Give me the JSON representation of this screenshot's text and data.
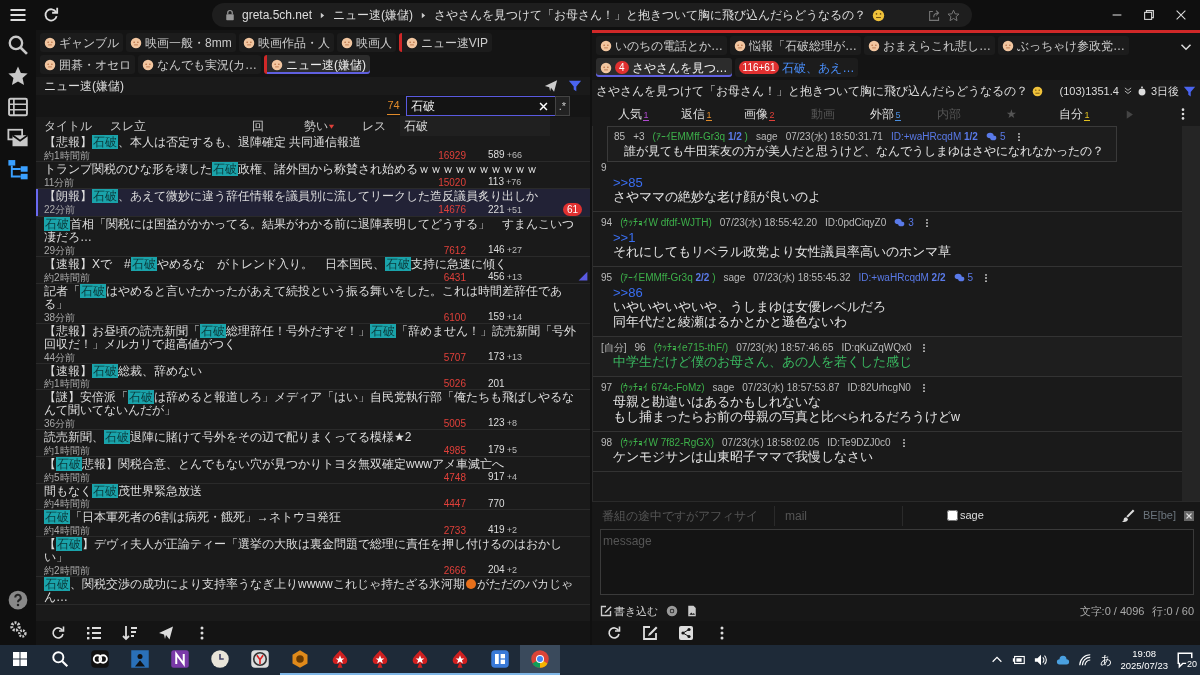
{
  "topbar": {
    "host": "greta.5ch.net",
    "crumbs": [
      "ニュー速(嫌儲)",
      "さやさんを見つけて「お母さん！」と抱きついて胸に飛び込んだらどうなるの？"
    ]
  },
  "sidebar": {
    "items": [
      {
        "kind": "search",
        "selected": false
      },
      {
        "kind": "star",
        "selected": false
      },
      {
        "kind": "list",
        "selected": false
      },
      {
        "kind": "mail",
        "selected": false
      },
      {
        "kind": "tree",
        "selected": true
      }
    ],
    "bottom": [
      {
        "kind": "help"
      },
      {
        "kind": "settings"
      }
    ]
  },
  "board_tabs": [
    {
      "label": "ギャンブル",
      "selected": false,
      "marked": false
    },
    {
      "label": "映画一般・8mm",
      "selected": false,
      "marked": false
    },
    {
      "label": "映画作品・人",
      "selected": false,
      "marked": false
    },
    {
      "label": "映画人",
      "selected": false,
      "marked": false
    },
    {
      "label": "ニュー速VIP",
      "selected": false,
      "marked": true
    },
    {
      "label": "囲碁・オセロ",
      "selected": false,
      "marked": false
    },
    {
      "label": "なんでも実況(カ…",
      "selected": false,
      "marked": false
    },
    {
      "label": "ニュー速(嫌儲)",
      "selected": true,
      "marked": true
    }
  ],
  "board_header": {
    "title": "ニュー速(嫌儲)"
  },
  "search": {
    "count": "74",
    "value": "石破",
    "regex": ".*",
    "suggestion": "石破"
  },
  "columns": [
    {
      "label": "タイトル",
      "sorted": false
    },
    {
      "label": "スレ立",
      "sorted": false
    },
    {
      "label": "回",
      "sorted": false
    },
    {
      "label": "勢い",
      "sorted": true
    },
    {
      "label": "レス",
      "sorted": false
    }
  ],
  "threads": [
    {
      "title": [
        {
          "kind": "plain",
          "text": "【悲報】"
        },
        {
          "kind": "match",
          "text": "石破"
        },
        {
          "kind": "plain",
          "text": "、本人は否定するも、退陣確定 共同通信報道"
        }
      ],
      "age": "約1時間前",
      "speed": "16929",
      "count": "589",
      "new": "+66",
      "selected": false,
      "flagged": false
    },
    {
      "title": [
        {
          "kind": "plain",
          "text": "トランプ関税のひな形を壊した"
        },
        {
          "kind": "match",
          "text": "石破"
        },
        {
          "kind": "plain",
          "text": "政権、諸外国から称賛され始めるｗｗｗｗｗｗｗｗｗｗ"
        }
      ],
      "age": "11分前",
      "speed": "15020",
      "count": "113",
      "new": "+76",
      "selected": false,
      "flagged": false
    },
    {
      "title": [
        {
          "kind": "plain",
          "text": "【朗報】"
        },
        {
          "kind": "match",
          "text": "石破"
        },
        {
          "kind": "plain",
          "text": "、あえて微妙に違う辞任情報を議員別に流してリークした造反議員炙り出しか"
        }
      ],
      "age": "22分前",
      "speed": "14676",
      "count": "221",
      "new": "+51",
      "badge": "61",
      "selected": true,
      "flagged": false
    },
    {
      "title": [
        {
          "kind": "match",
          "text": "石破"
        },
        {
          "kind": "plain",
          "text": "首相「関税には国益がかかってる。結果がわかる前に退陣表明してどうする」　すまんこいつ凄だろ…"
        }
      ],
      "age": "29分前",
      "speed": "7612",
      "count": "146",
      "new": "+27",
      "selected": false,
      "flagged": false
    },
    {
      "title": [
        {
          "kind": "plain",
          "text": "【速報】Xで　#"
        },
        {
          "kind": "match",
          "text": "石破"
        },
        {
          "kind": "plain",
          "text": "やめるな　がトレンド入り。　日本国民、"
        },
        {
          "kind": "match",
          "text": "石破"
        },
        {
          "kind": "plain",
          "text": "支持に急速に傾く"
        }
      ],
      "age": "約2時間前",
      "speed": "6431",
      "count": "456",
      "new": "+13",
      "selected": false,
      "flagged": true
    },
    {
      "title": [
        {
          "kind": "plain",
          "text": "記者「"
        },
        {
          "kind": "match",
          "text": "石破"
        },
        {
          "kind": "plain",
          "text": "はやめると言いたかったがあえて続投という振る舞いをした。これは時間差辞任である」"
        }
      ],
      "age": "38分前",
      "speed": "6100",
      "count": "159",
      "new": "+14",
      "selected": false,
      "flagged": false
    },
    {
      "title": [
        {
          "kind": "plain",
          "text": "【悲報】お昼頃の読売新聞「"
        },
        {
          "kind": "match",
          "text": "石破"
        },
        {
          "kind": "plain",
          "text": "総理辞任！号外だすぞ！」"
        },
        {
          "kind": "match",
          "text": "石破"
        },
        {
          "kind": "plain",
          "text": "「辞めません！」読売新聞「号外回収だ！」メルカリで超高値がつく"
        }
      ],
      "age": "44分前",
      "speed": "5707",
      "count": "173",
      "new": "+13",
      "selected": false,
      "flagged": false
    },
    {
      "title": [
        {
          "kind": "plain",
          "text": "【速報】"
        },
        {
          "kind": "match",
          "text": "石破"
        },
        {
          "kind": "plain",
          "text": "総裁、辞めない"
        }
      ],
      "age": "約1時間前",
      "speed": "5026",
      "count": "201",
      "selected": false,
      "flagged": false
    },
    {
      "title": [
        {
          "kind": "plain",
          "text": "【謎】安倍派「"
        },
        {
          "kind": "match",
          "text": "石破"
        },
        {
          "kind": "plain",
          "text": "は辞めると報道しろ」メディア「はい」自民党執行部「俺たちも飛ばしやるなんて聞いてないんだが」"
        }
      ],
      "age": "36分前",
      "speed": "5005",
      "count": "123",
      "new": "+8",
      "selected": false,
      "flagged": false
    },
    {
      "title": [
        {
          "kind": "plain",
          "text": "読売新聞、"
        },
        {
          "kind": "match",
          "text": "石破"
        },
        {
          "kind": "plain",
          "text": "退陣に賭けて号外をその辺で配りまくってる模様★2"
        }
      ],
      "age": "約1時間前",
      "speed": "4985",
      "count": "179",
      "new": "+5",
      "selected": false,
      "flagged": false
    },
    {
      "title": [
        {
          "kind": "plain",
          "text": "【"
        },
        {
          "kind": "match",
          "text": "石破"
        },
        {
          "kind": "plain",
          "text": "悲報】関税合意、とんでもない穴が見つかりトヨタ無双確定wwwアメ車滅亡へ"
        }
      ],
      "age": "約5時間前",
      "speed": "4748",
      "count": "917",
      "new": "+4",
      "selected": false,
      "flagged": false
    },
    {
      "title": [
        {
          "kind": "plain",
          "text": "間もなく"
        },
        {
          "kind": "match",
          "text": "石破"
        },
        {
          "kind": "plain",
          "text": "茂世界緊急放送"
        }
      ],
      "age": "約4時間前",
      "speed": "4447",
      "count": "770",
      "selected": false,
      "flagged": false
    },
    {
      "title": [
        {
          "kind": "match",
          "text": "石破"
        },
        {
          "kind": "plain",
          "text": "「日本軍死者の6割は病死・餓死」→ネトウヨ発狂"
        }
      ],
      "age": "約4時間前",
      "speed": "2733",
      "count": "419",
      "new": "+2",
      "selected": false,
      "flagged": false
    },
    {
      "title": [
        {
          "kind": "plain",
          "text": "【"
        },
        {
          "kind": "match",
          "text": "石破"
        },
        {
          "kind": "plain",
          "text": "】デヴィ夫人が正論ティー「選挙の大敗は裏金問題で総理に責任を押し付けるのはおかしい」"
        }
      ],
      "age": "約2時間前",
      "speed": "2666",
      "count": "204",
      "new": "+2",
      "selected": false,
      "flagged": false
    },
    {
      "title": [
        {
          "kind": "match",
          "text": "石破"
        },
        {
          "kind": "plain",
          "text": "、関税交渉の成功により支持率うなぎ上りwwwwこれじゃ持たざる氷河期"
        },
        {
          "kind": "dot"
        },
        {
          "kind": "plain",
          "text": "がただのバカじゃん…"
        }
      ],
      "selected": false,
      "flagged": false
    }
  ],
  "thread_tabs": [
    {
      "label": "いのちの電話とか…",
      "selected": false,
      "unread": false
    },
    {
      "label": "悩報「石破総理が…",
      "selected": false,
      "unread": false
    },
    {
      "label": "おまえらこれ悲し…",
      "selected": false,
      "unread": false
    },
    {
      "label": "ぶっちゃけ参政党…",
      "selected": false,
      "unread": false
    },
    {
      "label": "さやさんを見つ…",
      "badge": "4",
      "selected": true,
      "unread": false
    },
    {
      "label": "石破、あえ…",
      "badge": "116+61",
      "selected": false,
      "unread": true
    }
  ],
  "thread_header": {
    "title": "さやさんを見つけて「お母さん！」と抱きついて胸に飛び込んだらどうなるの？",
    "stats": "(103)1351.4",
    "expire": "3日後"
  },
  "filters": [
    {
      "label": "人気",
      "count": "1",
      "color": "#b04ad0",
      "disabled": false
    },
    {
      "label": "返信",
      "count": "1",
      "color": "#e08a2a",
      "disabled": false
    },
    {
      "label": "画像",
      "count": "2",
      "color": "#e0403a",
      "disabled": false
    },
    {
      "label": "動画",
      "disabled": true
    },
    {
      "label": "外部",
      "count": "5",
      "color": "#4a8ee0",
      "disabled": false
    },
    {
      "label": "内部",
      "disabled": true
    },
    {
      "label": "★",
      "disabled": true
    },
    {
      "label": "自分",
      "count": "1",
      "color": "#e0c020",
      "disabled": false
    }
  ],
  "quote_popup": {
    "number": "85",
    "plus": "+3",
    "name": "(ｱｰｲEMMff-Gr3q",
    "name_count": "1/2",
    "name_close": ")",
    "sage": "sage",
    "date": "07/23(水) 18:50:31.71",
    "id": "ID:+waHRcqdM",
    "id_count": "1/2",
    "replies": "5",
    "text": "誰が見ても牛田茉友の方が美人だと思うけど、なんでうしまゆはさやになれなかったの？"
  },
  "posts": [
    {
      "number": "9",
      "mine": false,
      "anchor": ">>85",
      "lines": [
        "さやママの絶妙な老け顔が良いのよ"
      ]
    },
    {
      "number": "94",
      "mine": false,
      "name": "(ｳｯﾁｮｲW dfdf-WJTH)",
      "date": "07/23(水) 18:55:42.20",
      "id": "ID:0pdCiqyZ0",
      "replies": "3",
      "anchor": ">>1",
      "lines": [
        "それにしてもリベラル政党より女性議員率高いのホンマ草"
      ]
    },
    {
      "number": "95",
      "mine": false,
      "name": "(ｱｰｲEMMff-Gr3q",
      "name_count": "2/2",
      "name_close": ")",
      "sage": "sage",
      "date": "07/23(水) 18:55:45.32",
      "id": "ID:+waHRcqdM",
      "id_count": "2/2",
      "replies": "5",
      "anchor": ">>86",
      "lines": [
        "いやいやいやいや、うしまゆは女優レベルだろ",
        "同年代だと綾瀬はるかとかと遜色ないわ"
      ]
    },
    {
      "tag": "[自分]",
      "number": "96",
      "mine": true,
      "name": "(ｳｯﾁｮｲe715-thF/)",
      "date": "07/23(水) 18:57:46.65",
      "id": "ID:qKuZqWQx0",
      "lines": [
        "中学生だけど僕のお母さん、あの人を若くした感じ"
      ]
    },
    {
      "number": "97",
      "mine": false,
      "name": "(ｳｯﾁｮｲ 674c-FoMz)",
      "sage": "sage",
      "date": "07/23(水) 18:57:53.87",
      "id": "ID:82UrhcgN0",
      "lines": [
        "母親と勘違いはあるかもしれないな",
        "もし捕まったらお前の母親の写真と比べられるだろうけどw"
      ]
    },
    {
      "number": "98",
      "mine": false,
      "name": "(ｳｯﾁｮｲW 7f82-RgGX)",
      "date": "07/23(水) 18:58:02.05",
      "id": "ID:Te9DZJ0c0",
      "lines": [
        "ケンモジサンは山東昭子ママで我慢しなさい"
      ]
    }
  ],
  "compose": {
    "name_placeholder": "番組の途中ですがアフィサイ",
    "mail_placeholder": "mail",
    "sage_label": "sage",
    "sage_checked": false,
    "be": "BE[be]",
    "message_placeholder": "message",
    "submit": "書き込む",
    "counter": "文字:0 / 4096",
    "line_counter": "行:0 / 60"
  },
  "taskbar": {
    "apps": [
      {
        "kind": "gg",
        "running": false
      },
      {
        "kind": "reader",
        "running": false
      },
      {
        "kind": "onenote",
        "running": false
      },
      {
        "kind": "clock",
        "running": false
      },
      {
        "kind": "yandex",
        "running": false
      },
      {
        "kind": "hex",
        "running": true
      },
      {
        "kind": "spade",
        "running": true
      },
      {
        "kind": "spade",
        "running": true
      },
      {
        "kind": "spade",
        "running": true
      },
      {
        "kind": "spade",
        "running": true
      },
      {
        "kind": "board",
        "running": true
      },
      {
        "kind": "chrome",
        "running": true
      }
    ],
    "ime": "あ",
    "time": "19:08",
    "date": "2025/07/23",
    "notifications": "20"
  }
}
